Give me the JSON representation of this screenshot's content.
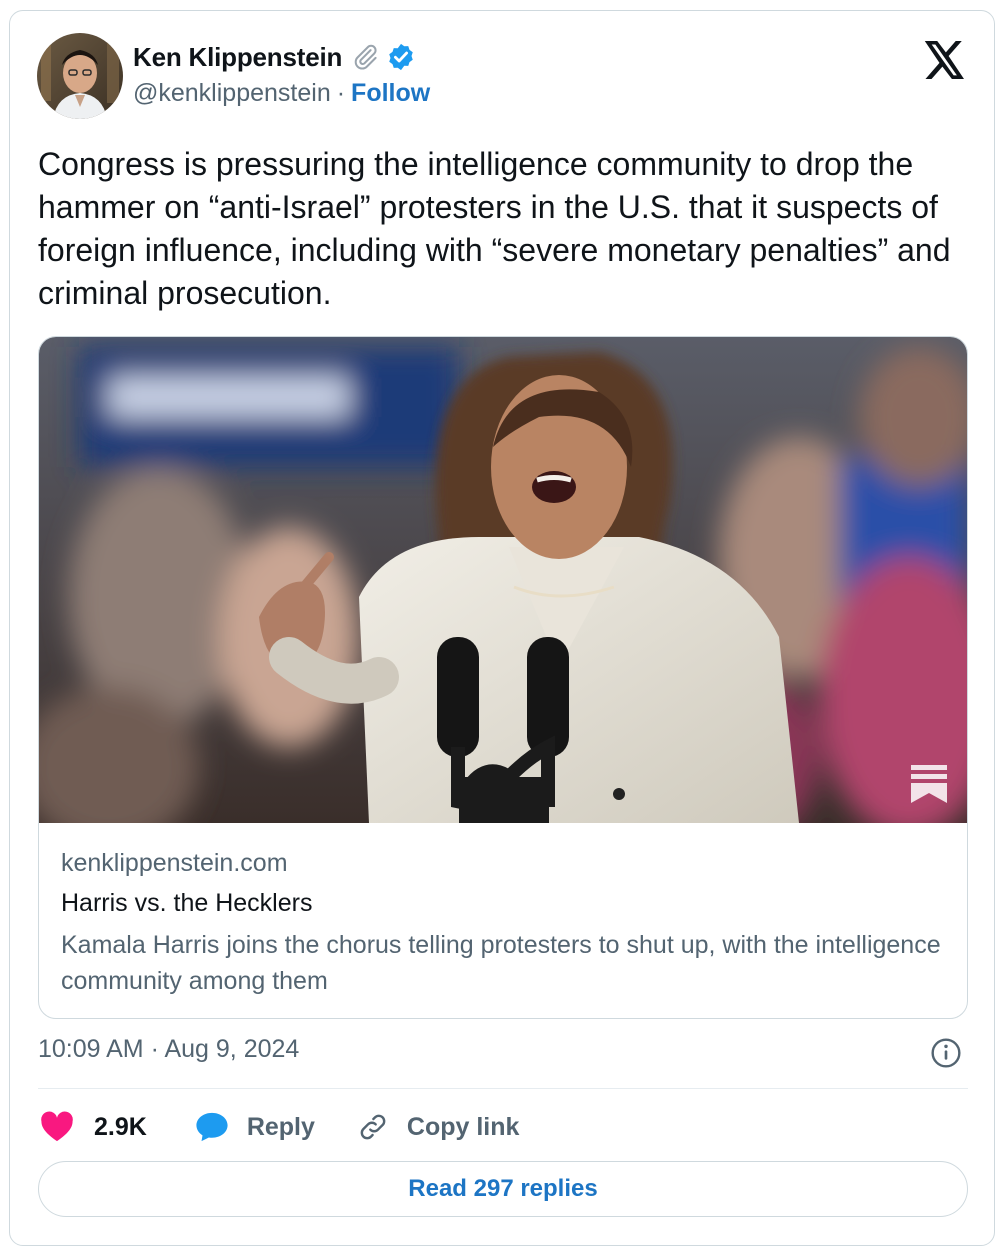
{
  "author": {
    "name": "Ken Klippenstein",
    "handle": "@kenklippenstein",
    "separator": "·",
    "follow_label": "Follow"
  },
  "tweet": {
    "text": "Congress is pressuring the intelligence community to drop the hammer on “anti-Israel” protesters in the U.S. that it suspects of foreign influence, including with “severe monetary penalties” and criminal prosecution."
  },
  "link_card": {
    "domain": "kenklippenstein.com",
    "title": "Harris vs. the Hecklers",
    "description": "Kamala Harris joins the chorus telling protesters to shut up, with the intelligence community among them"
  },
  "meta": {
    "timestamp": "10:09 AM · Aug 9, 2024"
  },
  "actions": {
    "likes": "2.9K",
    "reply_label": "Reply",
    "copy_label": "Copy link"
  },
  "read_replies_label": "Read 297 replies",
  "icons": [
    "paperclip-icon",
    "verified-badge-icon",
    "x-logo-icon",
    "info-icon",
    "heart-icon",
    "reply-icon",
    "link-icon",
    "bookmark-icon"
  ],
  "colors": {
    "accent": "#1d75c4",
    "verified": "#1d9bf0",
    "like": "#f91880",
    "secondary_text": "#536471",
    "border": "#cfd9de"
  }
}
